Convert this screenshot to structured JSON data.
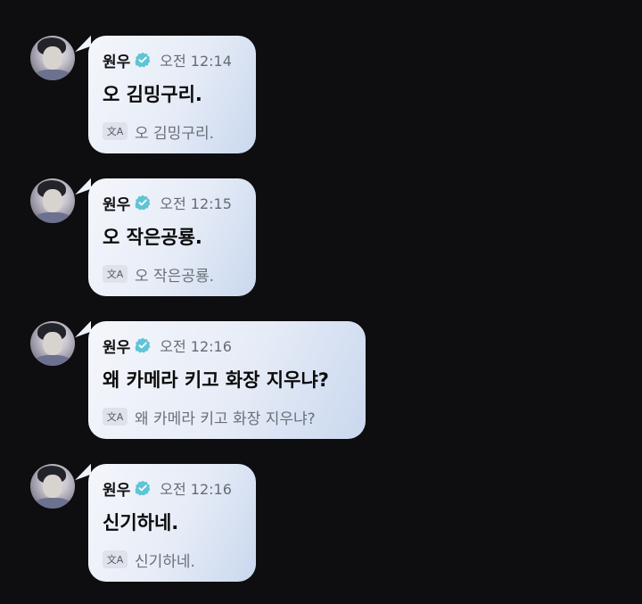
{
  "messages": [
    {
      "author": "원우",
      "time": "오전 12:14",
      "text": "오 김밍구리.",
      "translation": "오 김밍구리."
    },
    {
      "author": "원우",
      "time": "오전 12:15",
      "text": "오 작은공룡.",
      "translation": "오 작은공룡."
    },
    {
      "author": "원우",
      "time": "오전 12:16",
      "text": "왜 카메라 키고 화장 지우냐?",
      "translation": "왜 카메라 키고 화장 지우냐?"
    },
    {
      "author": "원우",
      "time": "오전 12:16",
      "text": "신기하네.",
      "translation": "신기하네."
    }
  ],
  "icons": {
    "verified": "verified-badge-icon",
    "translate": "translate-icon",
    "verified_color": "#5ec4d6"
  }
}
